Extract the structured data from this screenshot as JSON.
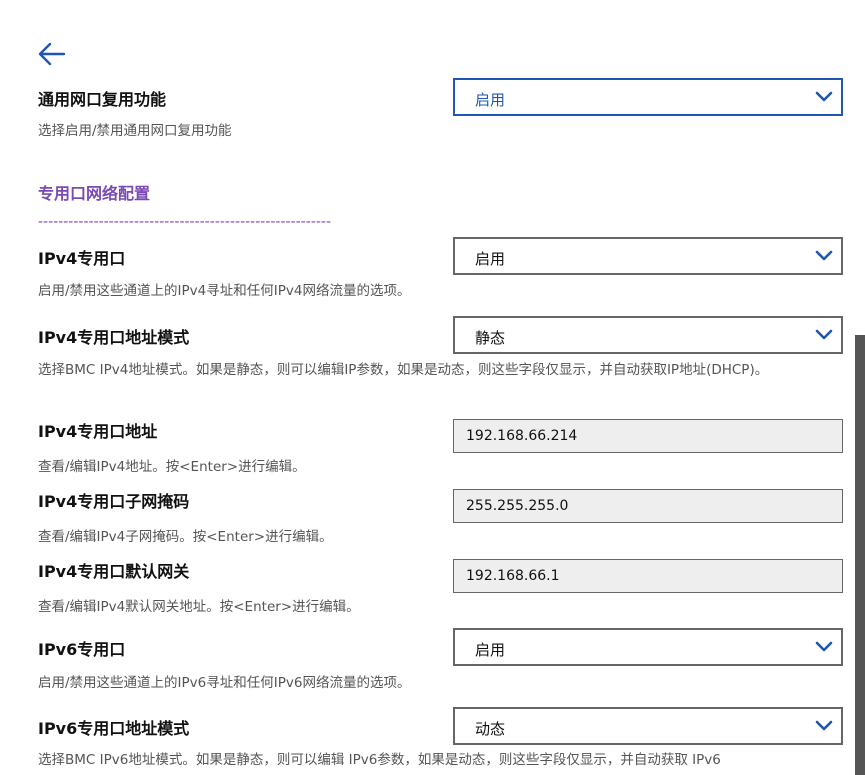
{
  "colors": {
    "accent": "#1f57b0",
    "section": "#7a4ab5",
    "description": "#555555",
    "textbox_bg": "#eeeeee"
  },
  "header": {
    "back_icon": "arrow-left-icon"
  },
  "general_port": {
    "label": "通用网口复用功能",
    "value": "启用",
    "description": "选择启用/禁用通用网口复用功能"
  },
  "section": {
    "title": "专用口网络配置",
    "rule": "----------------------------------------------------------"
  },
  "ipv4_port": {
    "label": "IPv4专用口",
    "value": "启用",
    "description": "启用/禁用这些通道上的IPv4寻址和任何IPv4网络流量的选项。"
  },
  "ipv4_mode": {
    "label": "IPv4专用口地址模式",
    "value": "静态",
    "description": "选择BMC IPv4地址模式。如果是静态，则可以编辑IP参数，如果是动态，则这些字段仅显示，并自动获取IP地址(DHCP)。"
  },
  "ipv4_address": {
    "label": "IPv4专用口地址",
    "value": "192.168.66.214",
    "description": "查看/编辑IPv4地址。按<Enter>进行编辑。"
  },
  "ipv4_subnet": {
    "label": "IPv4专用口子网掩码",
    "value": "255.255.255.0",
    "description": "查看/编辑IPv4子网掩码。按<Enter>进行编辑。"
  },
  "ipv4_gateway": {
    "label": "IPv4专用口默认网关",
    "value": "192.168.66.1",
    "description": "查看/编辑IPv4默认网关地址。按<Enter>进行编辑。"
  },
  "ipv6_port": {
    "label": "IPv6专用口",
    "value": "启用",
    "description": "启用/禁用这些通道上的IPv6寻址和任何IPv6网络流量的选项。"
  },
  "ipv6_mode": {
    "label": "IPv6专用口地址模式",
    "value": "动态",
    "description": "选择BMC IPv6地址模式。如果是静态，则可以编辑 IPv6参数，如果是动态，则这些字段仅显示，并自动获取 IPv6"
  }
}
